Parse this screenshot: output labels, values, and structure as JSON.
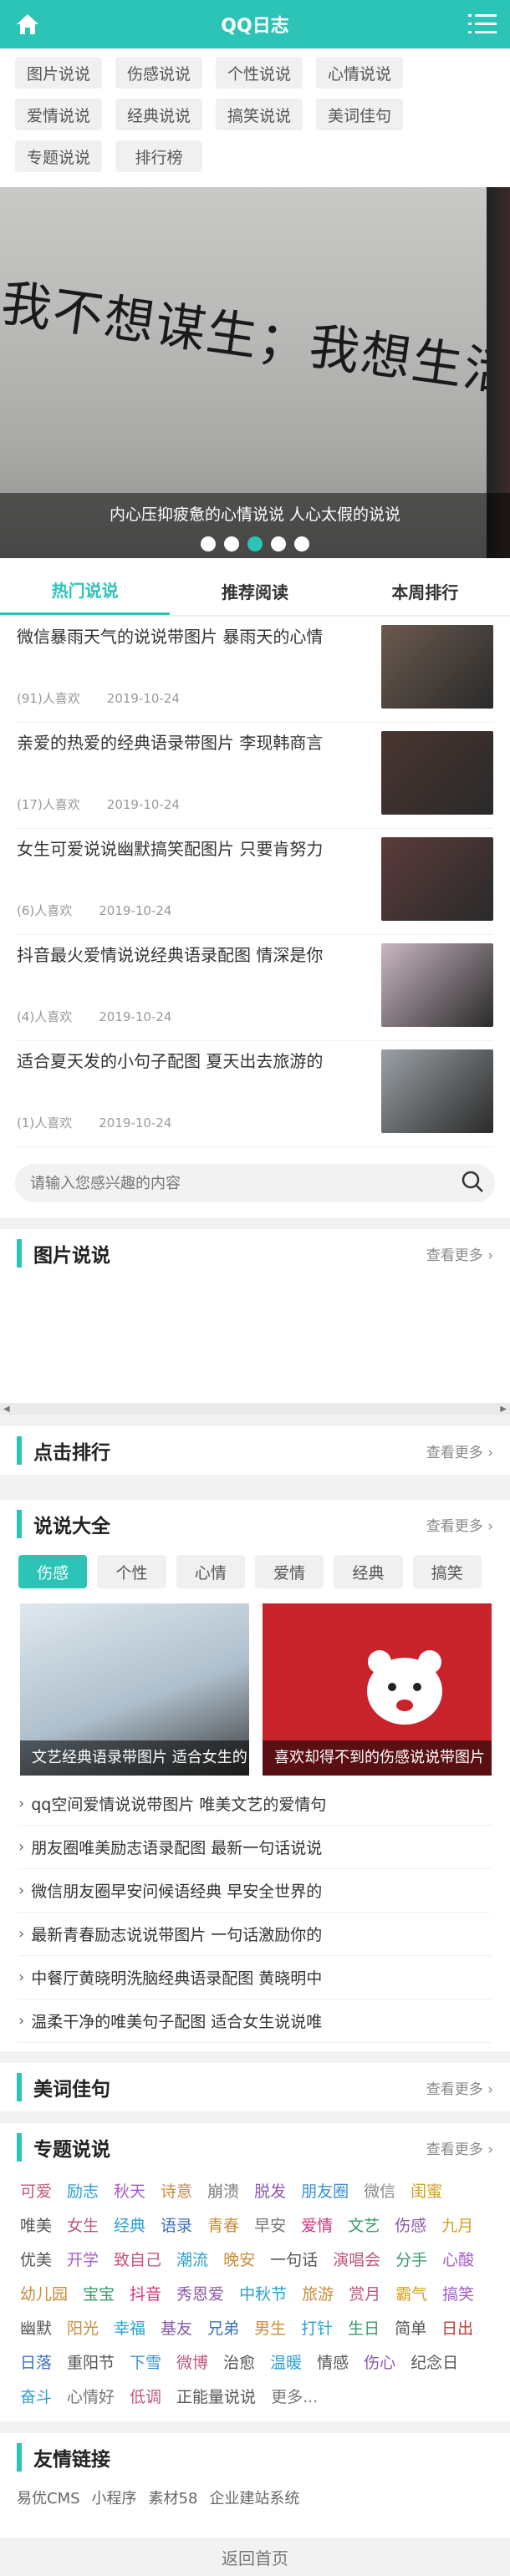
{
  "header": {
    "title": "QQ日志",
    "home_icon": "home-icon",
    "menu_icon": "menu-icon"
  },
  "categories": [
    "图片说说",
    "伤感说说",
    "个性说说",
    "心情说说",
    "爱情说说",
    "经典说说",
    "搞笑说说",
    "美词佳句",
    "专题说说",
    "排行榜"
  ],
  "banner": {
    "big_text": "我不想谋生；我想生活。",
    "caption": "内心压抑疲惫的心情说说 人心太假的说说",
    "slides": 5,
    "active_slide": 3
  },
  "tabs": [
    "热门说说",
    "推荐阅读",
    "本周排行"
  ],
  "articles": [
    {
      "title": "微信暴雨天气的说说带图片 暴雨天的心情",
      "likes": "(91)人喜欢",
      "date": "2019-10-24",
      "thumb": "#6b5a4f"
    },
    {
      "title": "亲爱的热爱的经典语录带图片 李现韩商言",
      "likes": "(17)人喜欢",
      "date": "2019-10-24",
      "thumb": "#4a3530"
    },
    {
      "title": "女生可爱说说幽默搞笑配图片 只要肯努力",
      "likes": "(6)人喜欢",
      "date": "2019-10-24",
      "thumb": "#5c3b3b"
    },
    {
      "title": "抖音最火爱情说说经典语录配图 情深是你",
      "likes": "(4)人喜欢",
      "date": "2019-10-24",
      "thumb": "#c9b6c2"
    },
    {
      "title": "适合夏天发的小句子配图 夏天出去旅游的",
      "likes": "(1)人喜欢",
      "date": "2019-10-24",
      "thumb": "#9aa1a6"
    }
  ],
  "search": {
    "placeholder": "请输入您感兴趣的内容"
  },
  "sections": {
    "pics": {
      "title": "图片说说",
      "more": "查看更多 ›"
    },
    "rank": {
      "title": "点击排行",
      "more": "查看更多 ›"
    },
    "all": {
      "title": "说说大全",
      "more": "查看更多 ›"
    },
    "words": {
      "title": "美词佳句",
      "more": "查看更多 ›"
    },
    "topics": {
      "title": "专题说说",
      "more": "查看更多 ›"
    },
    "links": {
      "title": "友情链接"
    }
  },
  "shuoshuo_tabs": [
    "伤感",
    "个性",
    "心情",
    "爱情",
    "经典",
    "搞笑"
  ],
  "shuoshuo_cards": [
    {
      "caption": "文艺经典语录带图片 适合女生的",
      "color": "#b9c9d6"
    },
    {
      "caption": "喜欢却得不到的伤感说说带图片",
      "color": "#c8232a"
    }
  ],
  "shuoshuo_list": [
    "qq空间爱情说说带图片 唯美文艺的爱情句",
    "朋友圈唯美励志语录配图 最新一句话说说",
    "微信朋友圈早安问候语经典 早安全世界的",
    "最新青春励志说说带图片 一句话激励你的",
    "中餐厅黄晓明洗脑经典语录配图 黄晓明中",
    "温柔干净的唯美句子配图 适合女生说说唯"
  ],
  "topic_tags": [
    {
      "t": "可爱",
      "c": "#c0577a"
    },
    {
      "t": "励志",
      "c": "#2b9fd0"
    },
    {
      "t": "秋天",
      "c": "#a35cc7"
    },
    {
      "t": "诗意",
      "c": "#c98d3a"
    },
    {
      "t": "崩溃",
      "c": "#7a7a7a"
    },
    {
      "t": "脱发",
      "c": "#8a5aa8"
    },
    {
      "t": "朋友圈",
      "c": "#3a8fd0"
    },
    {
      "t": "微信",
      "c": "#888888"
    },
    {
      "t": "闺蜜",
      "c": "#d4a020"
    },
    {
      "t": "唯美",
      "c": "#555555"
    },
    {
      "t": "女生",
      "c": "#c0577a"
    },
    {
      "t": "经典",
      "c": "#2b9fd0"
    },
    {
      "t": "语录",
      "c": "#3a70c0"
    },
    {
      "t": "青春",
      "c": "#c98d3a"
    },
    {
      "t": "早安",
      "c": "#777777"
    },
    {
      "t": "爱情",
      "c": "#d4337a"
    },
    {
      "t": "文艺",
      "c": "#3a9a6a"
    },
    {
      "t": "伤感",
      "c": "#8a5aa8"
    },
    {
      "t": "九月",
      "c": "#d4a020"
    },
    {
      "t": "优美",
      "c": "#555555"
    },
    {
      "t": "开学",
      "c": "#a35cc7"
    },
    {
      "t": "致自己",
      "c": "#c0577a"
    },
    {
      "t": "潮流",
      "c": "#2b9fd0"
    },
    {
      "t": "晚安",
      "c": "#c98d3a"
    },
    {
      "t": "一句话",
      "c": "#555555"
    },
    {
      "t": "演唱会",
      "c": "#c0577a"
    },
    {
      "t": "分手",
      "c": "#3a9a6a"
    },
    {
      "t": "心酸",
      "c": "#a35cc7"
    },
    {
      "t": "幼儿园",
      "c": "#c98d3a"
    },
    {
      "t": "宝宝",
      "c": "#3a9a6a"
    },
    {
      "t": "抖音",
      "c": "#d4337a"
    },
    {
      "t": "秀恩爱",
      "c": "#8a5aa8"
    },
    {
      "t": "中秋节",
      "c": "#2b9fd0"
    },
    {
      "t": "旅游",
      "c": "#c98d3a"
    },
    {
      "t": "赏月",
      "c": "#c0577a"
    },
    {
      "t": "霸气",
      "c": "#d4a020"
    },
    {
      "t": "搞笑",
      "c": "#a35cc7"
    },
    {
      "t": "幽默",
      "c": "#555555"
    },
    {
      "t": "阳光",
      "c": "#c98d3a"
    },
    {
      "t": "幸福",
      "c": "#2b9fd0"
    },
    {
      "t": "基友",
      "c": "#8a5aa8"
    },
    {
      "t": "兄弟",
      "c": "#3a70c0"
    },
    {
      "t": "男生",
      "c": "#c98d3a"
    },
    {
      "t": "打针",
      "c": "#2b9fd0"
    },
    {
      "t": "生日",
      "c": "#3a9a6a"
    },
    {
      "t": "简单",
      "c": "#555555"
    },
    {
      "t": "日出",
      "c": "#c0393a"
    },
    {
      "t": "日落",
      "c": "#3a70c0"
    },
    {
      "t": "重阳节",
      "c": "#555555"
    },
    {
      "t": "下雪",
      "c": "#3a8fd0"
    },
    {
      "t": "微博",
      "c": "#c0577a"
    },
    {
      "t": "治愈",
      "c": "#555555"
    },
    {
      "t": "温暖",
      "c": "#2b9fd0"
    },
    {
      "t": "情感",
      "c": "#555555"
    },
    {
      "t": "伤心",
      "c": "#8a5aa8"
    },
    {
      "t": "纪念日",
      "c": "#555555"
    },
    {
      "t": "奋斗",
      "c": "#2b9fd0"
    },
    {
      "t": "心情好",
      "c": "#777777"
    },
    {
      "t": "低调",
      "c": "#c0577a"
    },
    {
      "t": "正能量说说",
      "c": "#555555"
    },
    {
      "t": "更多...",
      "c": "#777777"
    }
  ],
  "friend_links": [
    "易优CMS",
    "小程序",
    "素材58",
    "企业建站系统"
  ],
  "footer": {
    "back_home": "返回首页"
  },
  "accent_color": "#2bc4b6"
}
